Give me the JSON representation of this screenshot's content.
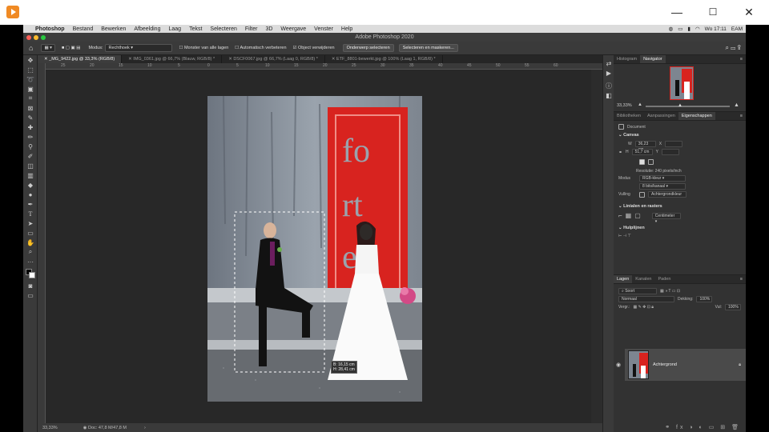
{
  "outer": {
    "minimize": "—",
    "maximize": "☐",
    "close": "✕"
  },
  "menubar": {
    "apple": "",
    "items": [
      "Photoshop",
      "Bestand",
      "Bewerken",
      "Afbeelding",
      "Laag",
      "Tekst",
      "Selecteren",
      "Filter",
      "3D",
      "Weergave",
      "Venster",
      "Help"
    ],
    "clock": "Wo 17:11",
    "user": "EAM"
  },
  "window_title": "Adobe Photoshop 2020",
  "options": {
    "modus_label": "Modus:",
    "modus_value": "Rechthoek",
    "sample_all": "Monster van alle lagen",
    "auto_enhance": "Automatisch verbeteren",
    "object_remove": "Object verwijderen",
    "select_subject": "Onderwerp selecteren",
    "select_mask": "Selecteren en maskeren..."
  },
  "tabs": [
    "_MG_9422.jpg @ 33,3% (RGB/8)",
    "IMG_0361.jpg @ 66,7% (Blauw, RGB/8) *",
    "DSCF0067.jpg @ 66,7% (Laag 0, RGB/8) *",
    "ETF_8801-bewerkt.jpg @ 100% (Laag 1, RGB/8) *"
  ],
  "ruler_ticks": [
    "25",
    "20",
    "15",
    "10",
    "5",
    "0",
    "5",
    "10",
    "15",
    "20",
    "25",
    "30",
    "35",
    "40",
    "45",
    "50",
    "55",
    "60"
  ],
  "selection_readout": {
    "w": "B: 16,15 cm",
    "h": "H: 28,41 cm"
  },
  "status": {
    "zoom": "33,33%",
    "doc": "Doc: 47,8 M/47,8 M"
  },
  "panel_top": {
    "tabs": [
      "Histogram",
      "Navigator"
    ],
    "zoom": "33,33%"
  },
  "properties": {
    "tabs": [
      "Bibliotheken",
      "Aanpassingen",
      "Eigenschappen"
    ],
    "doc_label": "Document",
    "canvas_title": "Canvas",
    "w_label": "W",
    "w_value": "36,23 cm",
    "x_label": "X",
    "h_label": "H",
    "h_value": "51,7 cm",
    "y_label": "Y",
    "resolution": "Resolutie: 240 pixels/inch",
    "modus_label": "Modus",
    "modus_value": "RGB-kleur",
    "bits_value": "8 bits/kanaal",
    "fill_label": "Vulling",
    "fill_value": "Achtergrondkleur",
    "rulers_title": "Linialen en rasters",
    "unit_value": "Centimeter",
    "guides_title": "Hulplijnen"
  },
  "layers": {
    "tabs": [
      "Lagen",
      "Kanalen",
      "Paden"
    ],
    "search": "Soort",
    "blend": "Normaal",
    "opacity_label": "Dekking:",
    "opacity_value": "100%",
    "lock_label": "Vergr.:",
    "fill_label": "Vul:",
    "fill_value": "100%",
    "layer_name": "Achtergrond"
  },
  "colors": {
    "accent": "#2d7bd8",
    "wall_red": "#d8231f",
    "ps_bg": "#2e2e2e"
  }
}
